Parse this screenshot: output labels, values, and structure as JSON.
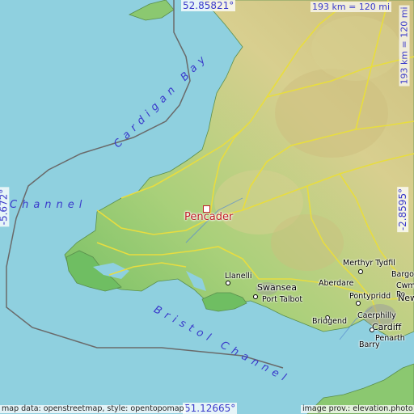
{
  "map": {
    "focus_place": "Pencader",
    "lat_top": "52.85821°",
    "lat_bottom": "51.12665°",
    "lon_left": "-5.672°",
    "lon_right": "-2.8595°",
    "scale_top": "193 km = 120 mi",
    "scale_right": "193 km = 120 mi",
    "attribution_left": "map data: openstreetmap, style: opentopomap",
    "attribution_right": "image prov.: elevation.photo",
    "seas": {
      "cardigan_bay": "Cardigan Bay",
      "channel": "Channel",
      "bristol_channel": "Bristol Channel"
    },
    "towns": {
      "llanelli": "Llanelli",
      "swansea": "Swansea",
      "port_talbot": "Port Talbot",
      "bridgend": "Bridgend",
      "aberdare": "Aberdare",
      "merthyr": "Merthyr Tydfil",
      "pontypridd": "Pontypridd",
      "caerphilly": "Caerphilly",
      "cardiff": "Cardiff",
      "penarth": "Penarth",
      "barry": "Barry",
      "newport": "New",
      "cwmbran": "Cwmb",
      "pontypool": "Po",
      "bargoed": "Bargoed"
    },
    "colors": {
      "sea": "#8fd0df",
      "lowland": "#7bc36a",
      "upland": "#d8cf8f",
      "road": "#e8dd3f",
      "focus": "#c0212a",
      "label_blue": "#3a3acb"
    }
  }
}
